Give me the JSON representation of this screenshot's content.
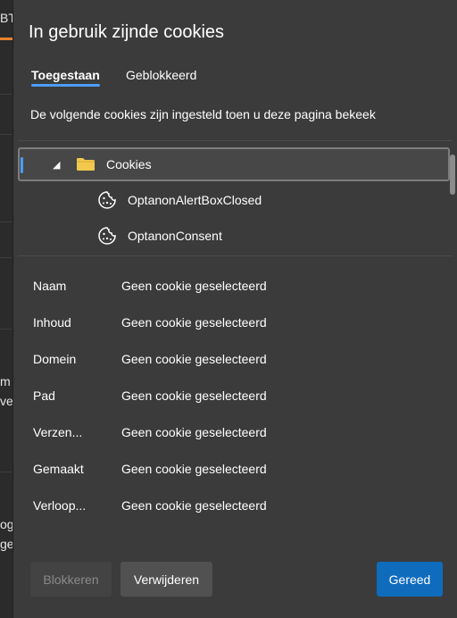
{
  "background": {
    "fragments": [
      "BTC",
      "m",
      "vel",
      "og",
      "ge"
    ]
  },
  "dialog": {
    "title": "In gebruik zijnde cookies",
    "tabs": [
      {
        "label": "Toegestaan",
        "active": true
      },
      {
        "label": "Geblokkeerd",
        "active": false
      }
    ],
    "description": "De volgende cookies zijn ingesteld toen u deze pagina bekeek",
    "tree": {
      "folder": {
        "label": "Cookies",
        "icon": "folder-icon",
        "expanded": true,
        "selected": true
      },
      "items": [
        {
          "label": "OptanonAlertBoxClosed",
          "icon": "cookie-icon"
        },
        {
          "label": "OptanonConsent",
          "icon": "cookie-icon"
        }
      ]
    },
    "properties": [
      {
        "key": "Naam",
        "value": "Geen cookie geselecteerd"
      },
      {
        "key": "Inhoud",
        "value": "Geen cookie geselecteerd"
      },
      {
        "key": "Domein",
        "value": "Geen cookie geselecteerd"
      },
      {
        "key": "Pad",
        "value": "Geen cookie geselecteerd"
      },
      {
        "key": "Verzen...",
        "value": "Geen cookie geselecteerd"
      },
      {
        "key": "Gemaakt",
        "value": "Geen cookie geselecteerd"
      },
      {
        "key": "Verloop...",
        "value": "Geen cookie geselecteerd"
      }
    ],
    "buttons": {
      "block": "Blokkeren",
      "remove": "Verwijderen",
      "done": "Gereed"
    }
  },
  "colors": {
    "accent": "#4a9eff",
    "primary_button": "#0f6cbd",
    "folder": "#f2c94c"
  }
}
